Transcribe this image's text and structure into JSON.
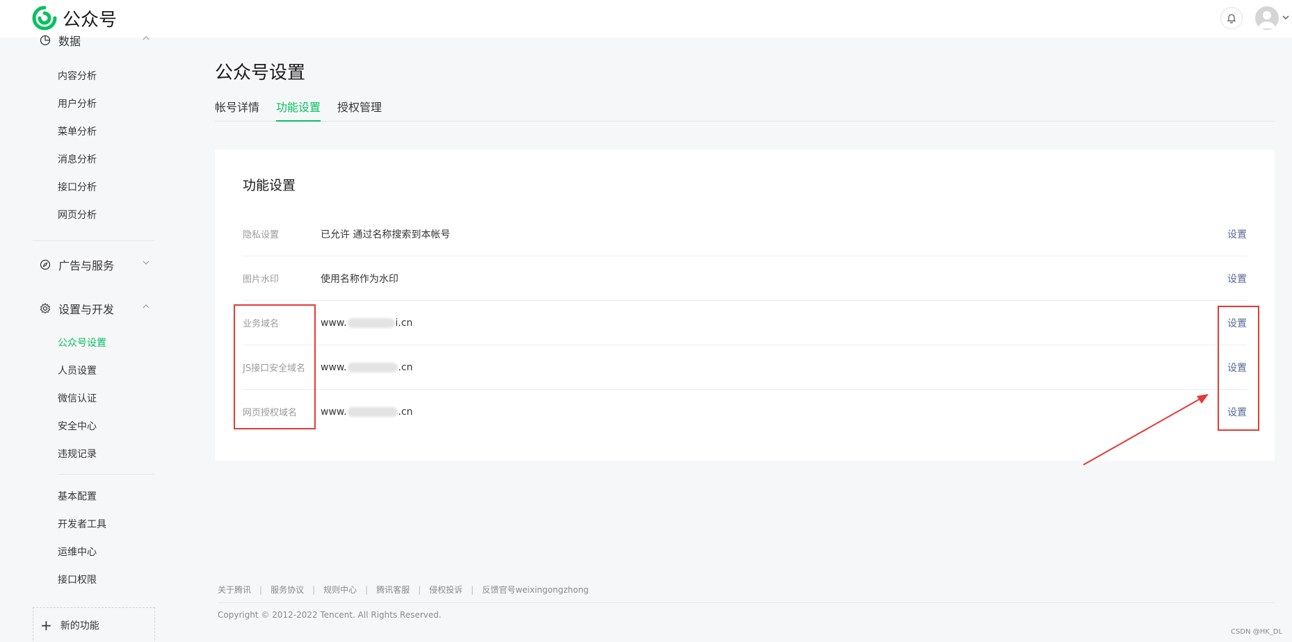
{
  "header": {
    "brand": "公众号",
    "bell_icon": "bell-icon",
    "avatar_icon": "user-avatar-icon"
  },
  "sidebar": {
    "data_group": {
      "label": "数据",
      "icon": "chart-circle-icon",
      "items": [
        "内容分析",
        "用户分析",
        "菜单分析",
        "消息分析",
        "接口分析",
        "网页分析"
      ]
    },
    "ads_group": {
      "label": "广告与服务",
      "icon": "compass-icon"
    },
    "settings_group": {
      "label": "设置与开发",
      "icon": "gear-icon",
      "items": [
        "公众号设置",
        "人员设置",
        "微信认证",
        "安全中心",
        "违规记录"
      ],
      "active": "公众号设置",
      "dev_items": [
        "基本配置",
        "开发者工具",
        "运维中心",
        "接口权限"
      ]
    },
    "new_feature": "新的功能"
  },
  "main": {
    "page_title": "公众号设置",
    "tabs": [
      "帐号详情",
      "功能设置",
      "授权管理"
    ],
    "active_tab": "功能设置",
    "card_title": "功能设置",
    "rows": [
      {
        "label": "隐私设置",
        "value": "已允许 通过名称搜索到本帐号",
        "action": "设置"
      },
      {
        "label": "图片水印",
        "value": "使用名称作为水印",
        "action": "设置"
      },
      {
        "label": "业务域名",
        "value_prefix": "www.",
        "value_suffix": "i.cn",
        "action": "设置"
      },
      {
        "label": "JS接口安全域名",
        "value_prefix": "www.",
        "value_suffix": ".cn",
        "action": "设置"
      },
      {
        "label": "网页授权域名",
        "value_prefix": "www.",
        "value_suffix": ".cn",
        "action": "设置"
      }
    ]
  },
  "footer": {
    "links": [
      "关于腾讯",
      "服务协议",
      "规则中心",
      "腾讯客服",
      "侵权投诉",
      "反馈官号weixingongzhong"
    ],
    "copyright": "Copyright © 2012-2022 Tencent. All Rights Reserved.",
    "watermark": "CSDN @HK_DL"
  },
  "colors": {
    "accent": "#07c160",
    "link": "#576b95",
    "annotation": "#e53935"
  }
}
